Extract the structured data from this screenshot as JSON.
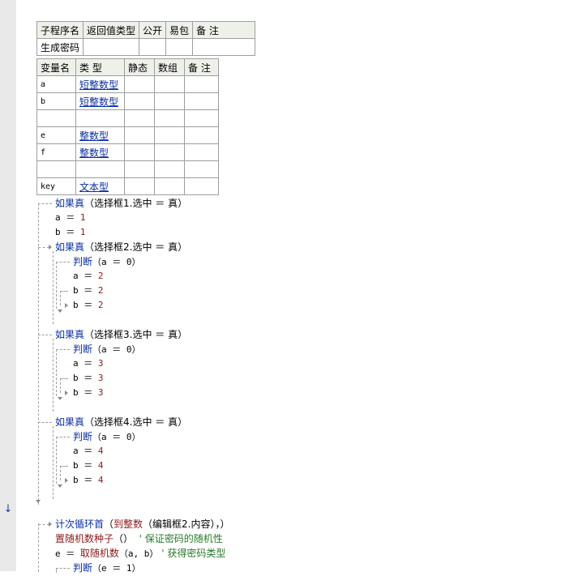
{
  "subroutine_table": {
    "headers": [
      "子程序名",
      "返回值类型",
      "公开",
      "易包",
      "备 注"
    ],
    "row": {
      "name": "生成密码",
      "return_type": "",
      "public": "",
      "epkg": "",
      "note": ""
    }
  },
  "variable_table": {
    "headers": [
      "变量名",
      "类 型",
      "静态",
      "数组",
      "备 注"
    ],
    "rows": [
      {
        "name": "a",
        "type": "短整数型"
      },
      {
        "name": "b",
        "type": "短整数型"
      },
      {
        "name": "",
        "type": ""
      },
      {
        "name": "e",
        "type": "整数型"
      },
      {
        "name": "f",
        "type": "整数型"
      },
      {
        "name": "",
        "type": ""
      },
      {
        "name": "key",
        "type": "文本型"
      }
    ]
  },
  "code": {
    "if1": {
      "kw": "如果真",
      "cond": "（选择框1.选中 ＝ 真）"
    },
    "if1_a": {
      "lhs": "a ＝ ",
      "val": "1"
    },
    "if1_b": {
      "lhs": "b ＝ ",
      "val": "1"
    },
    "if2": {
      "kw": "如果真",
      "cond": "（选择框2.选中 ＝ 真）"
    },
    "if2_judge": {
      "kw": "判断",
      "cond": "（a ＝ 0）"
    },
    "if2_a": {
      "lhs": "a ＝ ",
      "val": "2"
    },
    "if2_b1": {
      "lhs": "b ＝ ",
      "val": "2"
    },
    "if2_b2": {
      "lhs": "b ＝ ",
      "val": "2"
    },
    "if3": {
      "kw": "如果真",
      "cond": "（选择框3.选中 ＝ 真）"
    },
    "if3_judge": {
      "kw": "判断",
      "cond": "（a ＝ 0）"
    },
    "if3_a": {
      "lhs": "a ＝ ",
      "val": "3"
    },
    "if3_b1": {
      "lhs": "b ＝ ",
      "val": "3"
    },
    "if3_b2": {
      "lhs": "b ＝ ",
      "val": "3"
    },
    "if4": {
      "kw": "如果真",
      "cond": "（选择框4.选中 ＝ 真）"
    },
    "if4_judge": {
      "kw": "判断",
      "cond": "（a ＝ 0）"
    },
    "if4_a": {
      "lhs": "a ＝ ",
      "val": "4"
    },
    "if4_b1": {
      "lhs": "b ＝ ",
      "val": "4"
    },
    "if4_b2": {
      "lhs": "b ＝ ",
      "val": "4"
    },
    "loop": {
      "kw": "计次循环首",
      "open": "（",
      "func": "到整数",
      "arg": "（编辑框2.内容），）"
    },
    "seed": {
      "func": "置随机数种子",
      "args": "（）",
      "comment": "' 保证密码的随机性"
    },
    "rand": {
      "lhs": "e ＝ ",
      "func": "取随机数",
      "args": "（a, b）",
      "comment": "' 获得密码类型"
    },
    "judge_e": {
      "kw": "判断",
      "cond": "（e ＝ 1）"
    }
  },
  "colors": {
    "keyword": "#0b2fa8",
    "value": "#8b1a1a",
    "comment": "#2a7a2a",
    "gutter": "#e9e9e9"
  },
  "icons": {
    "breakpoint": "down-arrow-icon"
  }
}
